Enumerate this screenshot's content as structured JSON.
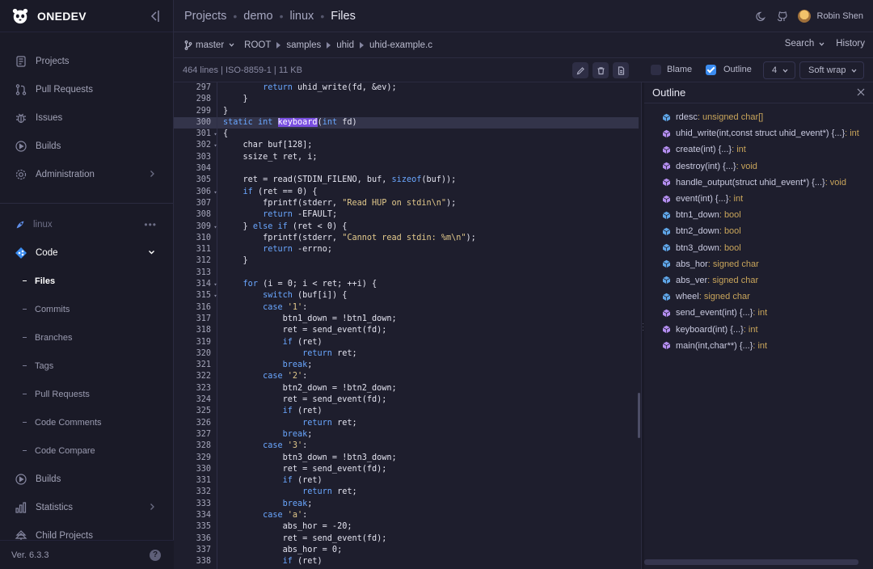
{
  "app": {
    "brand": "ONEDEV",
    "version": "Ver. 6.3.3"
  },
  "sidebar": {
    "items": [
      {
        "label": "Projects",
        "icon": "projects-icon"
      },
      {
        "label": "Pull Requests",
        "icon": "pull-request-icon"
      },
      {
        "label": "Issues",
        "icon": "bug-icon"
      },
      {
        "label": "Builds",
        "icon": "play-circle-icon"
      },
      {
        "label": "Administration",
        "icon": "gear-icon"
      }
    ],
    "project": {
      "name": "linux",
      "more": "•••"
    },
    "code": {
      "label": "Code"
    },
    "code_sub": [
      {
        "label": "Files",
        "active": true
      },
      {
        "label": "Commits"
      },
      {
        "label": "Branches"
      },
      {
        "label": "Tags"
      },
      {
        "label": "Pull Requests"
      },
      {
        "label": "Code Comments"
      },
      {
        "label": "Code Compare"
      }
    ],
    "bottom_items": [
      {
        "label": "Builds"
      },
      {
        "label": "Statistics"
      },
      {
        "label": "Child Projects"
      }
    ],
    "help": "?"
  },
  "header": {
    "breadcrumb": [
      "Projects",
      "demo",
      "linux",
      "Files"
    ],
    "user": "Robin Shen"
  },
  "path": {
    "branch": "master",
    "segments": [
      "ROOT",
      "samples",
      "uhid",
      "uhid-example.c"
    ],
    "search": "Search",
    "history": "History"
  },
  "toolbar": {
    "file_info": "464 lines | ISO-8859-1 | 11 KB",
    "blame_label": "Blame",
    "blame_checked": false,
    "outline_label": "Outline",
    "outline_checked": true,
    "indent_value": "4",
    "wrap_value": "Soft wrap"
  },
  "code_lines": [
    {
      "n": "297",
      "f": "",
      "h": false,
      "t": [
        [
          "        ",
          ""
        ],
        [
          "return",
          "kw"
        ],
        [
          " uhid_write(fd, &ev);",
          ""
        ]
      ]
    },
    {
      "n": "298",
      "f": "",
      "h": false,
      "t": [
        [
          "    }",
          ""
        ]
      ]
    },
    {
      "n": "299",
      "f": "",
      "h": false,
      "t": [
        [
          "}",
          ""
        ]
      ]
    },
    {
      "n": "300",
      "f": "",
      "h": true,
      "t": [
        [
          "static",
          "kw"
        ],
        [
          " ",
          ""
        ],
        [
          "int",
          "kw"
        ],
        [
          " ",
          ""
        ],
        [
          "keyboard",
          "fn-hl"
        ],
        [
          "(",
          ""
        ],
        [
          "int",
          "kw"
        ],
        [
          " fd)",
          ""
        ]
      ]
    },
    {
      "n": "301",
      "f": "▾",
      "h": false,
      "t": [
        [
          "{",
          ""
        ]
      ]
    },
    {
      "n": "302",
      "f": "▾",
      "h": false,
      "t": [
        [
          "    char buf[128];",
          ""
        ]
      ]
    },
    {
      "n": "303",
      "f": "",
      "h": false,
      "t": [
        [
          "    ssize_t ret, i;",
          ""
        ]
      ]
    },
    {
      "n": "304",
      "f": "",
      "h": false,
      "t": [
        [
          "",
          ""
        ]
      ]
    },
    {
      "n": "305",
      "f": "",
      "h": false,
      "t": [
        [
          "    ret = read(STDIN_FILENO, buf, ",
          ""
        ],
        [
          "sizeof",
          "kw"
        ],
        [
          "(buf));",
          ""
        ]
      ]
    },
    {
      "n": "306",
      "f": "▾",
      "h": false,
      "t": [
        [
          "    ",
          ""
        ],
        [
          "if",
          "kw"
        ],
        [
          " (ret == 0) {",
          ""
        ]
      ]
    },
    {
      "n": "307",
      "f": "",
      "h": false,
      "t": [
        [
          "        fprintf(stderr, ",
          ""
        ],
        [
          "\"Read HUP on stdin\\n\"",
          "st"
        ],
        [
          ");",
          ""
        ]
      ]
    },
    {
      "n": "308",
      "f": "",
      "h": false,
      "t": [
        [
          "        ",
          ""
        ],
        [
          "return",
          "kw"
        ],
        [
          " -EFAULT;",
          ""
        ]
      ]
    },
    {
      "n": "309",
      "f": "▾",
      "h": false,
      "t": [
        [
          "    } ",
          ""
        ],
        [
          "else if",
          "kw"
        ],
        [
          " (ret < 0) {",
          ""
        ]
      ]
    },
    {
      "n": "310",
      "f": "",
      "h": false,
      "t": [
        [
          "        fprintf(stderr, ",
          ""
        ],
        [
          "\"Cannot read stdin: %m\\n\"",
          "st"
        ],
        [
          ");",
          ""
        ]
      ]
    },
    {
      "n": "311",
      "f": "",
      "h": false,
      "t": [
        [
          "        ",
          ""
        ],
        [
          "return",
          "kw"
        ],
        [
          " -errno;",
          ""
        ]
      ]
    },
    {
      "n": "312",
      "f": "",
      "h": false,
      "t": [
        [
          "    }",
          ""
        ]
      ]
    },
    {
      "n": "313",
      "f": "",
      "h": false,
      "t": [
        [
          "",
          ""
        ]
      ]
    },
    {
      "n": "314",
      "f": "▾",
      "h": false,
      "t": [
        [
          "    ",
          ""
        ],
        [
          "for",
          "kw"
        ],
        [
          " (i = 0; i < ret; ++i) {",
          ""
        ]
      ]
    },
    {
      "n": "315",
      "f": "▾",
      "h": false,
      "t": [
        [
          "        ",
          ""
        ],
        [
          "switch",
          "kw"
        ],
        [
          " (buf[i]) {",
          ""
        ]
      ]
    },
    {
      "n": "316",
      "f": "",
      "h": false,
      "t": [
        [
          "        ",
          ""
        ],
        [
          "case",
          "kw"
        ],
        [
          " ",
          ""
        ],
        [
          "'1'",
          "st"
        ],
        [
          ":",
          ""
        ]
      ]
    },
    {
      "n": "317",
      "f": "",
      "h": false,
      "t": [
        [
          "            btn1_down = !btn1_down;",
          ""
        ]
      ]
    },
    {
      "n": "318",
      "f": "",
      "h": false,
      "t": [
        [
          "            ret = send_event(fd);",
          ""
        ]
      ]
    },
    {
      "n": "319",
      "f": "",
      "h": false,
      "t": [
        [
          "            ",
          ""
        ],
        [
          "if",
          "kw"
        ],
        [
          " (ret)",
          ""
        ]
      ]
    },
    {
      "n": "320",
      "f": "",
      "h": false,
      "t": [
        [
          "                ",
          ""
        ],
        [
          "return",
          "kw"
        ],
        [
          " ret;",
          ""
        ]
      ]
    },
    {
      "n": "321",
      "f": "",
      "h": false,
      "t": [
        [
          "            ",
          ""
        ],
        [
          "break",
          "kw"
        ],
        [
          ";",
          ""
        ]
      ]
    },
    {
      "n": "322",
      "f": "",
      "h": false,
      "t": [
        [
          "        ",
          ""
        ],
        [
          "case",
          "kw"
        ],
        [
          " ",
          ""
        ],
        [
          "'2'",
          "st"
        ],
        [
          ":",
          ""
        ]
      ]
    },
    {
      "n": "323",
      "f": "",
      "h": false,
      "t": [
        [
          "            btn2_down = !btn2_down;",
          ""
        ]
      ]
    },
    {
      "n": "324",
      "f": "",
      "h": false,
      "t": [
        [
          "            ret = send_event(fd);",
          ""
        ]
      ]
    },
    {
      "n": "325",
      "f": "",
      "h": false,
      "t": [
        [
          "            ",
          ""
        ],
        [
          "if",
          "kw"
        ],
        [
          " (ret)",
          ""
        ]
      ]
    },
    {
      "n": "326",
      "f": "",
      "h": false,
      "t": [
        [
          "                ",
          ""
        ],
        [
          "return",
          "kw"
        ],
        [
          " ret;",
          ""
        ]
      ]
    },
    {
      "n": "327",
      "f": "",
      "h": false,
      "t": [
        [
          "            ",
          ""
        ],
        [
          "break",
          "kw"
        ],
        [
          ";",
          ""
        ]
      ]
    },
    {
      "n": "328",
      "f": "",
      "h": false,
      "t": [
        [
          "        ",
          ""
        ],
        [
          "case",
          "kw"
        ],
        [
          " ",
          ""
        ],
        [
          "'3'",
          "st"
        ],
        [
          ":",
          ""
        ]
      ]
    },
    {
      "n": "329",
      "f": "",
      "h": false,
      "t": [
        [
          "            btn3_down = !btn3_down;",
          ""
        ]
      ]
    },
    {
      "n": "330",
      "f": "",
      "h": false,
      "t": [
        [
          "            ret = send_event(fd);",
          ""
        ]
      ]
    },
    {
      "n": "331",
      "f": "",
      "h": false,
      "t": [
        [
          "            ",
          ""
        ],
        [
          "if",
          "kw"
        ],
        [
          " (ret)",
          ""
        ]
      ]
    },
    {
      "n": "332",
      "f": "",
      "h": false,
      "t": [
        [
          "                ",
          ""
        ],
        [
          "return",
          "kw"
        ],
        [
          " ret;",
          ""
        ]
      ]
    },
    {
      "n": "333",
      "f": "",
      "h": false,
      "t": [
        [
          "            ",
          ""
        ],
        [
          "break",
          "kw"
        ],
        [
          ";",
          ""
        ]
      ]
    },
    {
      "n": "334",
      "f": "",
      "h": false,
      "t": [
        [
          "        ",
          ""
        ],
        [
          "case",
          "kw"
        ],
        [
          " ",
          ""
        ],
        [
          "'a'",
          "st"
        ],
        [
          ":",
          ""
        ]
      ]
    },
    {
      "n": "335",
      "f": "",
      "h": false,
      "t": [
        [
          "            abs_hor = -20;",
          ""
        ]
      ]
    },
    {
      "n": "336",
      "f": "",
      "h": false,
      "t": [
        [
          "            ret = send_event(fd);",
          ""
        ]
      ]
    },
    {
      "n": "337",
      "f": "",
      "h": false,
      "t": [
        [
          "            abs_hor = 0;",
          ""
        ]
      ]
    },
    {
      "n": "338",
      "f": "",
      "h": false,
      "t": [
        [
          "            ",
          ""
        ],
        [
          "if",
          "kw"
        ],
        [
          " (ret)",
          ""
        ]
      ]
    }
  ],
  "outline": {
    "title": "Outline",
    "items": [
      {
        "name": "rdesc",
        "type": " : unsigned char[]",
        "kind": "variable"
      },
      {
        "name": "uhid_write(int,const struct uhid_event*) {...}",
        "type": " : int",
        "kind": "function"
      },
      {
        "name": "create(int) {...}",
        "type": " : int",
        "kind": "function"
      },
      {
        "name": "destroy(int) {...}",
        "type": " : void",
        "kind": "function"
      },
      {
        "name": "handle_output(struct uhid_event*) {...}",
        "type": " : void",
        "kind": "function"
      },
      {
        "name": "event(int) {...}",
        "type": " : int",
        "kind": "function"
      },
      {
        "name": "btn1_down",
        "type": " : bool",
        "kind": "variable"
      },
      {
        "name": "btn2_down",
        "type": " : bool",
        "kind": "variable"
      },
      {
        "name": "btn3_down",
        "type": " : bool",
        "kind": "variable"
      },
      {
        "name": "abs_hor",
        "type": " : signed char",
        "kind": "variable"
      },
      {
        "name": "abs_ver",
        "type": " : signed char",
        "kind": "variable"
      },
      {
        "name": "wheel",
        "type": " : signed char",
        "kind": "variable"
      },
      {
        "name": "send_event(int) {...}",
        "type": " : int",
        "kind": "function"
      },
      {
        "name": "keyboard(int) {...}",
        "type": " : int",
        "kind": "function"
      },
      {
        "name": "main(int,char**) {...}",
        "type": " : int",
        "kind": "function"
      }
    ]
  },
  "colors": {
    "accent": "#3b8cf0",
    "highlight": "#7a4fe0",
    "keyword": "#6aa7ff",
    "string": "#e1c88b",
    "type": "#c9a55b"
  }
}
